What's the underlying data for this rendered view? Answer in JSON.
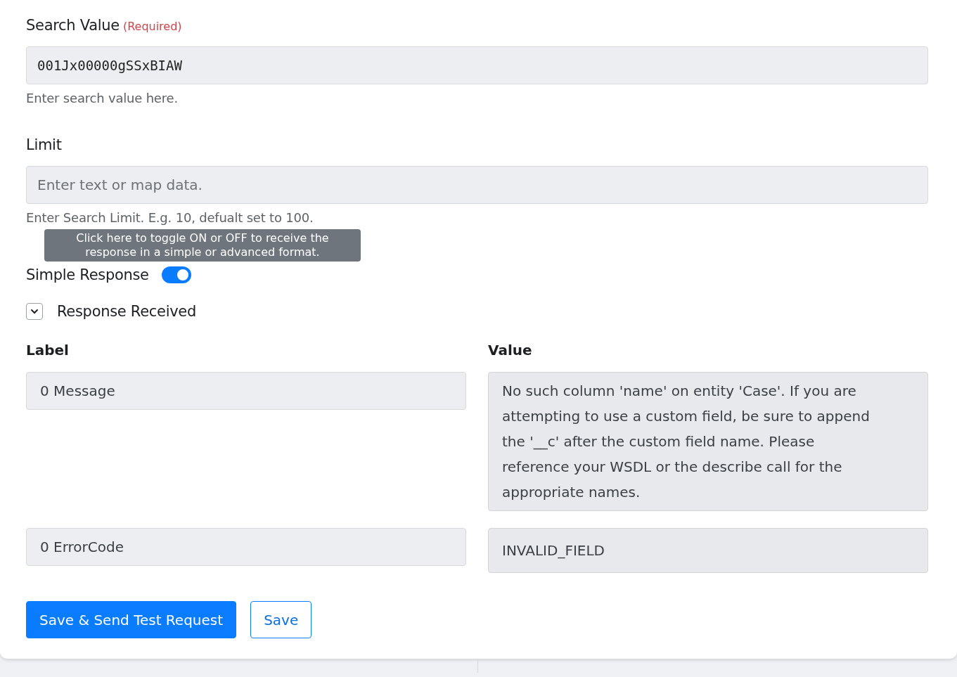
{
  "search_value": {
    "label": "Search Value",
    "required": "(Required)",
    "value": "001Jx00000gSSxBIAW",
    "hint": "Enter search value here."
  },
  "limit": {
    "label": "Limit",
    "placeholder": "Enter text or map data.",
    "hint": "Enter Search Limit. E.g. 10, defualt set to 100."
  },
  "tooltip": {
    "text": "Click here to toggle ON or OFF to receive the response in a simple or advanced format."
  },
  "simple_response": {
    "label": "Simple Response",
    "on": true
  },
  "response_received": {
    "label": "Response Received",
    "expanded": true
  },
  "response_table": {
    "columns": [
      "Label",
      "Value"
    ],
    "rows": [
      {
        "label": "0 Message",
        "value": "No such column 'name' on entity 'Case'. If you are attempting to use a custom field, be sure to append the '__c' after the custom field name. Please reference your WSDL or the describe call for the appropriate names."
      },
      {
        "label": "0 ErrorCode",
        "value": "INVALID_FIELD"
      }
    ]
  },
  "buttons": [
    {
      "label": "Save & Send Test Request",
      "kind": "primary"
    },
    {
      "label": "Save",
      "kind": "outline"
    }
  ]
}
